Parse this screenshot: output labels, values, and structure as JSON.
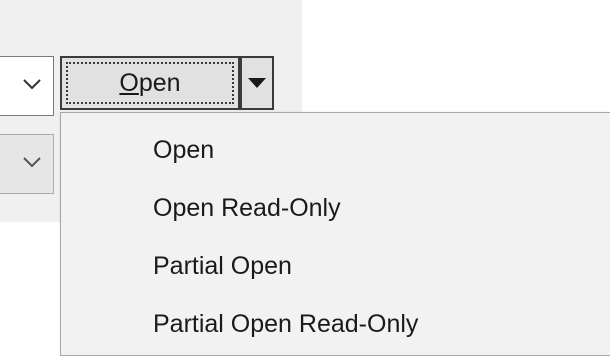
{
  "open_button": {
    "label_underlined": "O",
    "label_rest": "pen"
  },
  "menu": {
    "items": [
      {
        "label": "Open"
      },
      {
        "label": "Open Read-Only"
      },
      {
        "label": "Partial Open"
      },
      {
        "label": "Partial Open Read-Only"
      }
    ]
  },
  "icons": {
    "combo_chevron": "chevron-down-icon",
    "split_arrow": "triangle-down-icon"
  },
  "colors": {
    "dialog_background": "#f0f0f0",
    "menu_background": "#f2f2f2",
    "button_face": "#e1e1e1",
    "text": "#1a1a1a"
  }
}
